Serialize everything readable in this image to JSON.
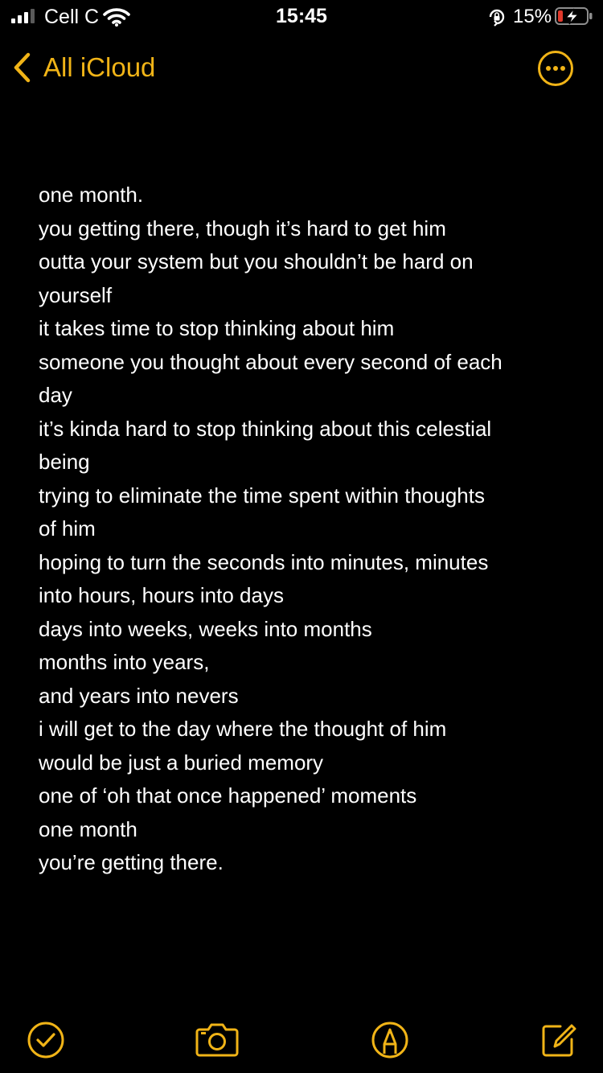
{
  "status_bar": {
    "carrier": "Cell C",
    "time": "15:45",
    "battery_percent": "15%",
    "icons": [
      "signal-bars-icon",
      "wifi-icon",
      "orientation-lock-icon",
      "battery-charging-icon"
    ]
  },
  "nav": {
    "back_label": "All iCloud",
    "back_icon": "chevron-left-icon",
    "more_icon": "ellipsis-circle-icon"
  },
  "note": {
    "lines": [
      "one month.",
      "you getting there, though it’s hard to get him",
      "outta your system but you shouldn’t be hard on",
      "yourself",
      "it takes time to stop thinking about him",
      "someone you thought about every second of each",
      "day",
      "it’s kinda hard to stop thinking about this celestial",
      "being",
      "trying to eliminate the time spent within thoughts",
      "of him",
      "hoping to turn the seconds into minutes, minutes",
      "into hours, hours into days",
      "days into weeks, weeks into months",
      "months into years,",
      "and years into nevers",
      "i will get to the day where the thought of him",
      "would be just a buried memory",
      "one of ‘oh that once happened’ moments",
      "one month",
      "you’re getting there."
    ]
  },
  "toolbar": {
    "icons": [
      "checklist-icon",
      "camera-icon",
      "markup-pen-icon",
      "compose-icon"
    ]
  },
  "colors": {
    "background": "#000000",
    "accent": "#f1b417",
    "text": "#ffffff",
    "battery_low": "#e0392b"
  }
}
